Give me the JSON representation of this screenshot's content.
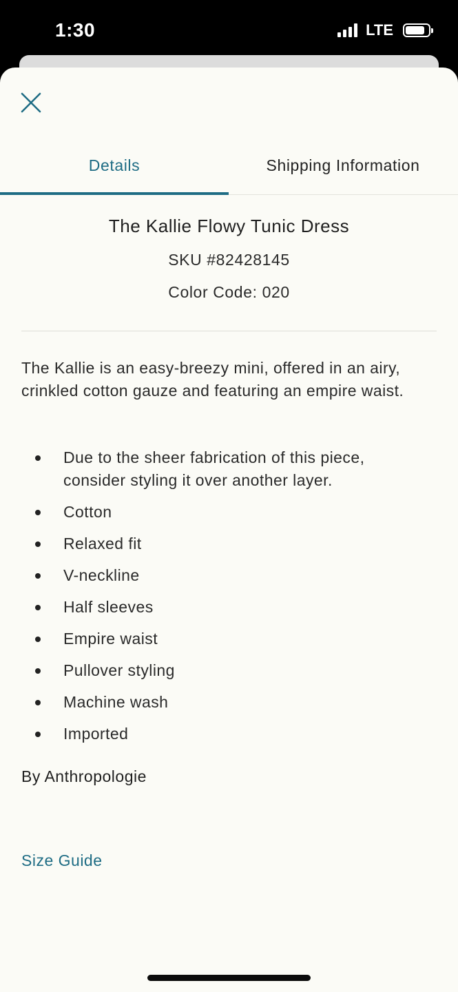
{
  "status_bar": {
    "time": "1:30",
    "network": "LTE",
    "signal_bars": 4,
    "battery_level": 0.85
  },
  "icons": {
    "close": "close-icon",
    "signal": "signal-icon",
    "battery": "battery-icon"
  },
  "colors": {
    "accent": "#1e6c84",
    "sheet_background": "#fbfbf6",
    "text": "#2a2a2a"
  },
  "tabs": [
    {
      "label": "Details",
      "active": true
    },
    {
      "label": "Shipping Information",
      "active": false
    }
  ],
  "product": {
    "title": "The Kallie Flowy Tunic Dress",
    "sku": "SKU #82428145",
    "color_code": "Color Code: 020",
    "description": "The Kallie is an easy-breezy mini, offered in an airy, crinkled cotton gauze and featuring an empire waist.",
    "features": [
      "Due to the sheer fabrication of this piece, consider styling it over another layer.",
      "Cotton",
      "Relaxed fit",
      "V-neckline",
      "Half sleeves",
      "Empire waist",
      "Pullover styling",
      "Machine wash",
      "Imported"
    ],
    "brand": "By Anthropologie"
  },
  "links": {
    "size_guide": "Size Guide"
  }
}
